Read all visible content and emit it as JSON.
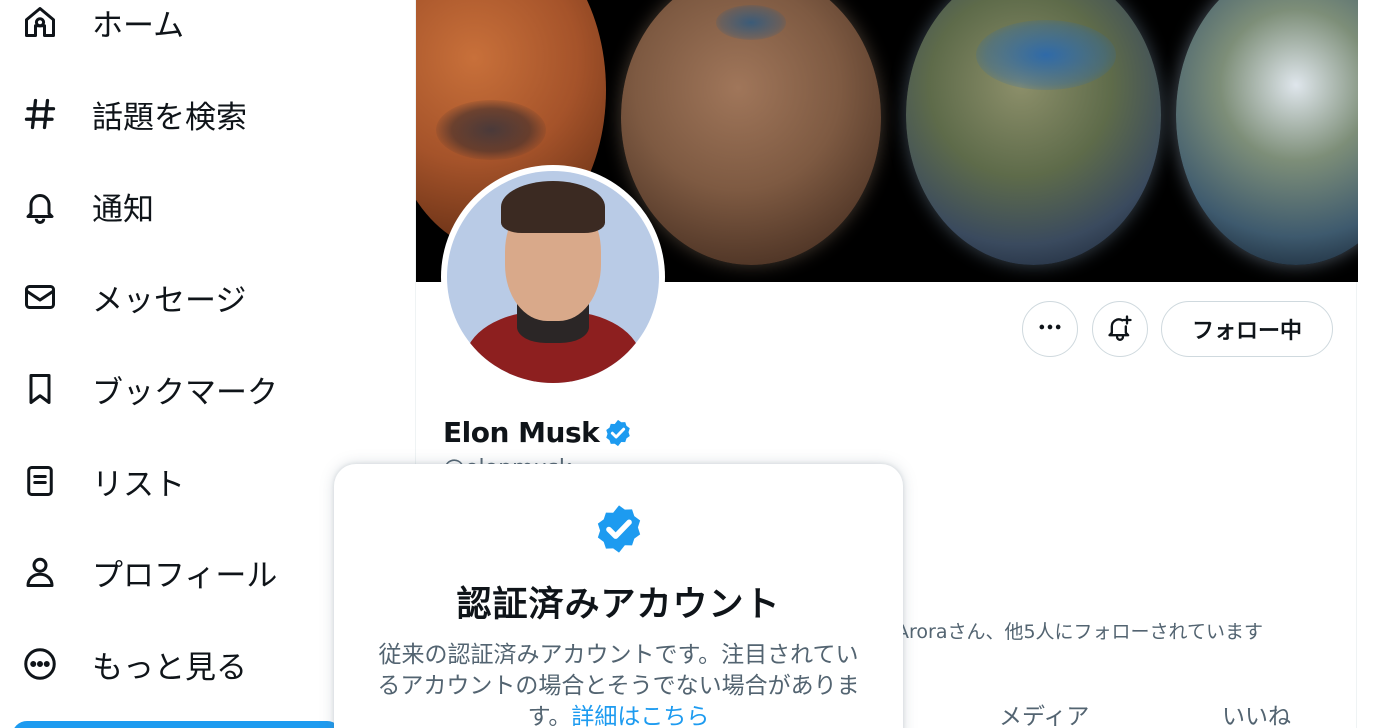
{
  "sidebar": {
    "items": [
      {
        "label": "ホーム",
        "icon": "home-icon"
      },
      {
        "label": "話題を検索",
        "icon": "hashtag-icon"
      },
      {
        "label": "通知",
        "icon": "bell-icon"
      },
      {
        "label": "メッセージ",
        "icon": "envelope-icon"
      },
      {
        "label": "ブックマーク",
        "icon": "bookmark-icon"
      },
      {
        "label": "リスト",
        "icon": "list-icon"
      },
      {
        "label": "プロフィール",
        "icon": "person-icon"
      },
      {
        "label": "もっと見る",
        "icon": "more-circle-icon"
      }
    ]
  },
  "profile": {
    "display_name": "Elon Musk",
    "handle": "@elonmusk",
    "follow_label": "フォロー中",
    "followed_by": "Aroraさん、他5人にフォローされています",
    "tabs": [
      "メディア",
      "いいね"
    ]
  },
  "popover": {
    "title": "認証済みアカウント",
    "body": "従来の認証済みアカウントです。注目されているアカウントの場合とそうでない場合があります。",
    "link": "詳細はこちら"
  },
  "colors": {
    "accent": "#1d9bf0",
    "text_primary": "#0f1419",
    "text_secondary": "#536471",
    "border": "#cfd9de"
  }
}
